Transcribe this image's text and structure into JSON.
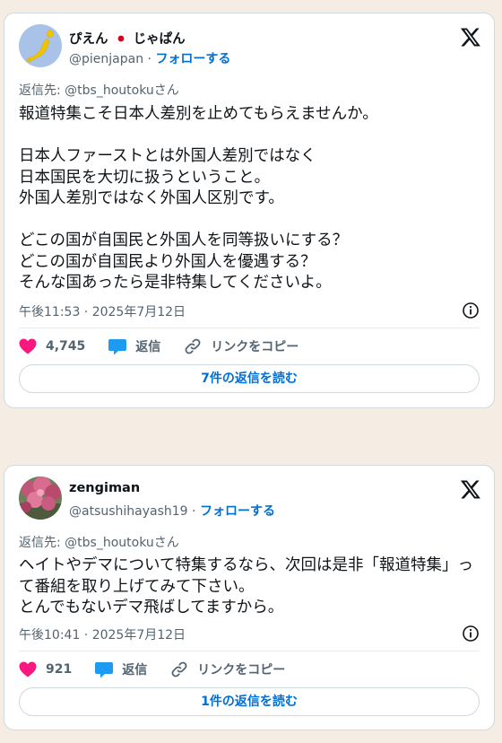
{
  "tweets": [
    {
      "display_name": "ぴえん",
      "display_name_suffix": "じゃぱん",
      "handle": "@pienjapan",
      "follow_label": "フォローする",
      "reply_prefix": "返信先: ",
      "reply_handle": "@tbs_houtoku",
      "reply_suffix": "さん",
      "text": "報道特集こそ日本人差別を止めてもらえませんか。\n\n日本人ファーストとは外国人差別ではなく\n日本国民を大切に扱うということ。\n外国人差別ではなく外国人区別です。\n\nどこの国が自国民と外国人を同等扱いにする？\nどこの国が自国民より外国人を優遇する？\nそんな国あったら是非特集してくださいよ。",
      "timestamp": "午後11:53 · 2025年7月12日",
      "likes": "4,745",
      "reply_label": "返信",
      "copy_link_label": "リンクをコピー",
      "read_replies_label": "7件の返信を読む"
    },
    {
      "display_name": "zengiman",
      "handle": "@atsushihayash19",
      "follow_label": "フォローする",
      "reply_prefix": "返信先: ",
      "reply_handle": "@tbs_houtoku",
      "reply_suffix": "さん",
      "text": "ヘイトやデマについて特集するなら、次回は是非「報道特集」って番組を取り上げてみて下さい。\nとんでもないデマ飛ばしてますから。",
      "timestamp": "午後10:41 · 2025年7月12日",
      "likes": "921",
      "reply_label": "返信",
      "copy_link_label": "リンクをコピー",
      "read_replies_label": "1件の返信を読む"
    }
  ],
  "colors": {
    "background": "#f5ede3",
    "like": "#f91880",
    "reply": "#1d9bf0",
    "link": "#006fd6"
  },
  "icons": [
    "japan-map-avatar",
    "blossom-avatar",
    "x-logo-icon",
    "info-icon",
    "heart-icon",
    "reply-bubble-icon",
    "link-icon",
    "japan-flag-icon"
  ]
}
